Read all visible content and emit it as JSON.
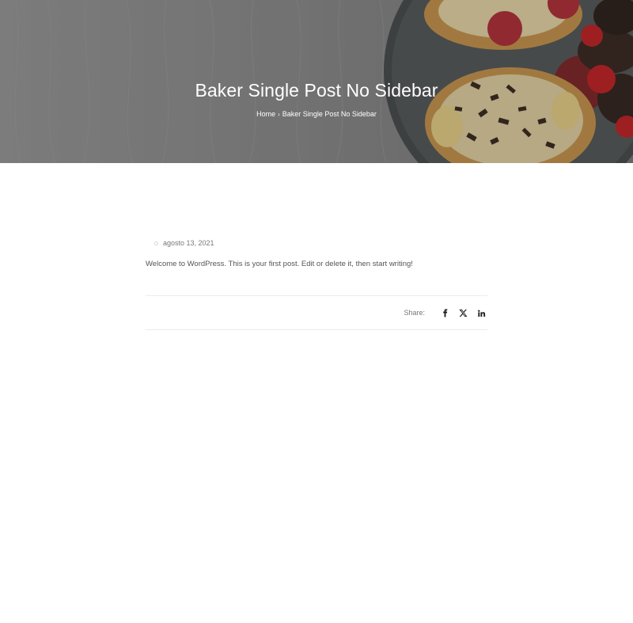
{
  "hero": {
    "title": "Baker Single Post No Sidebar",
    "breadcrumb": {
      "home": "Home",
      "separator": "›",
      "current": "Baker Single Post No Sidebar"
    }
  },
  "post": {
    "date": "agosto 13, 2021",
    "body": "Welcome to WordPress. This is your first post. Edit or delete it, then start writing!"
  },
  "share": {
    "label": "Share:",
    "icons": [
      "facebook-icon",
      "x-twitter-icon",
      "linkedin-icon"
    ]
  },
  "colors": {
    "icon": "#1a1a1a",
    "muted_text": "#777777",
    "body_text": "#555555",
    "divider": "#ececec"
  }
}
